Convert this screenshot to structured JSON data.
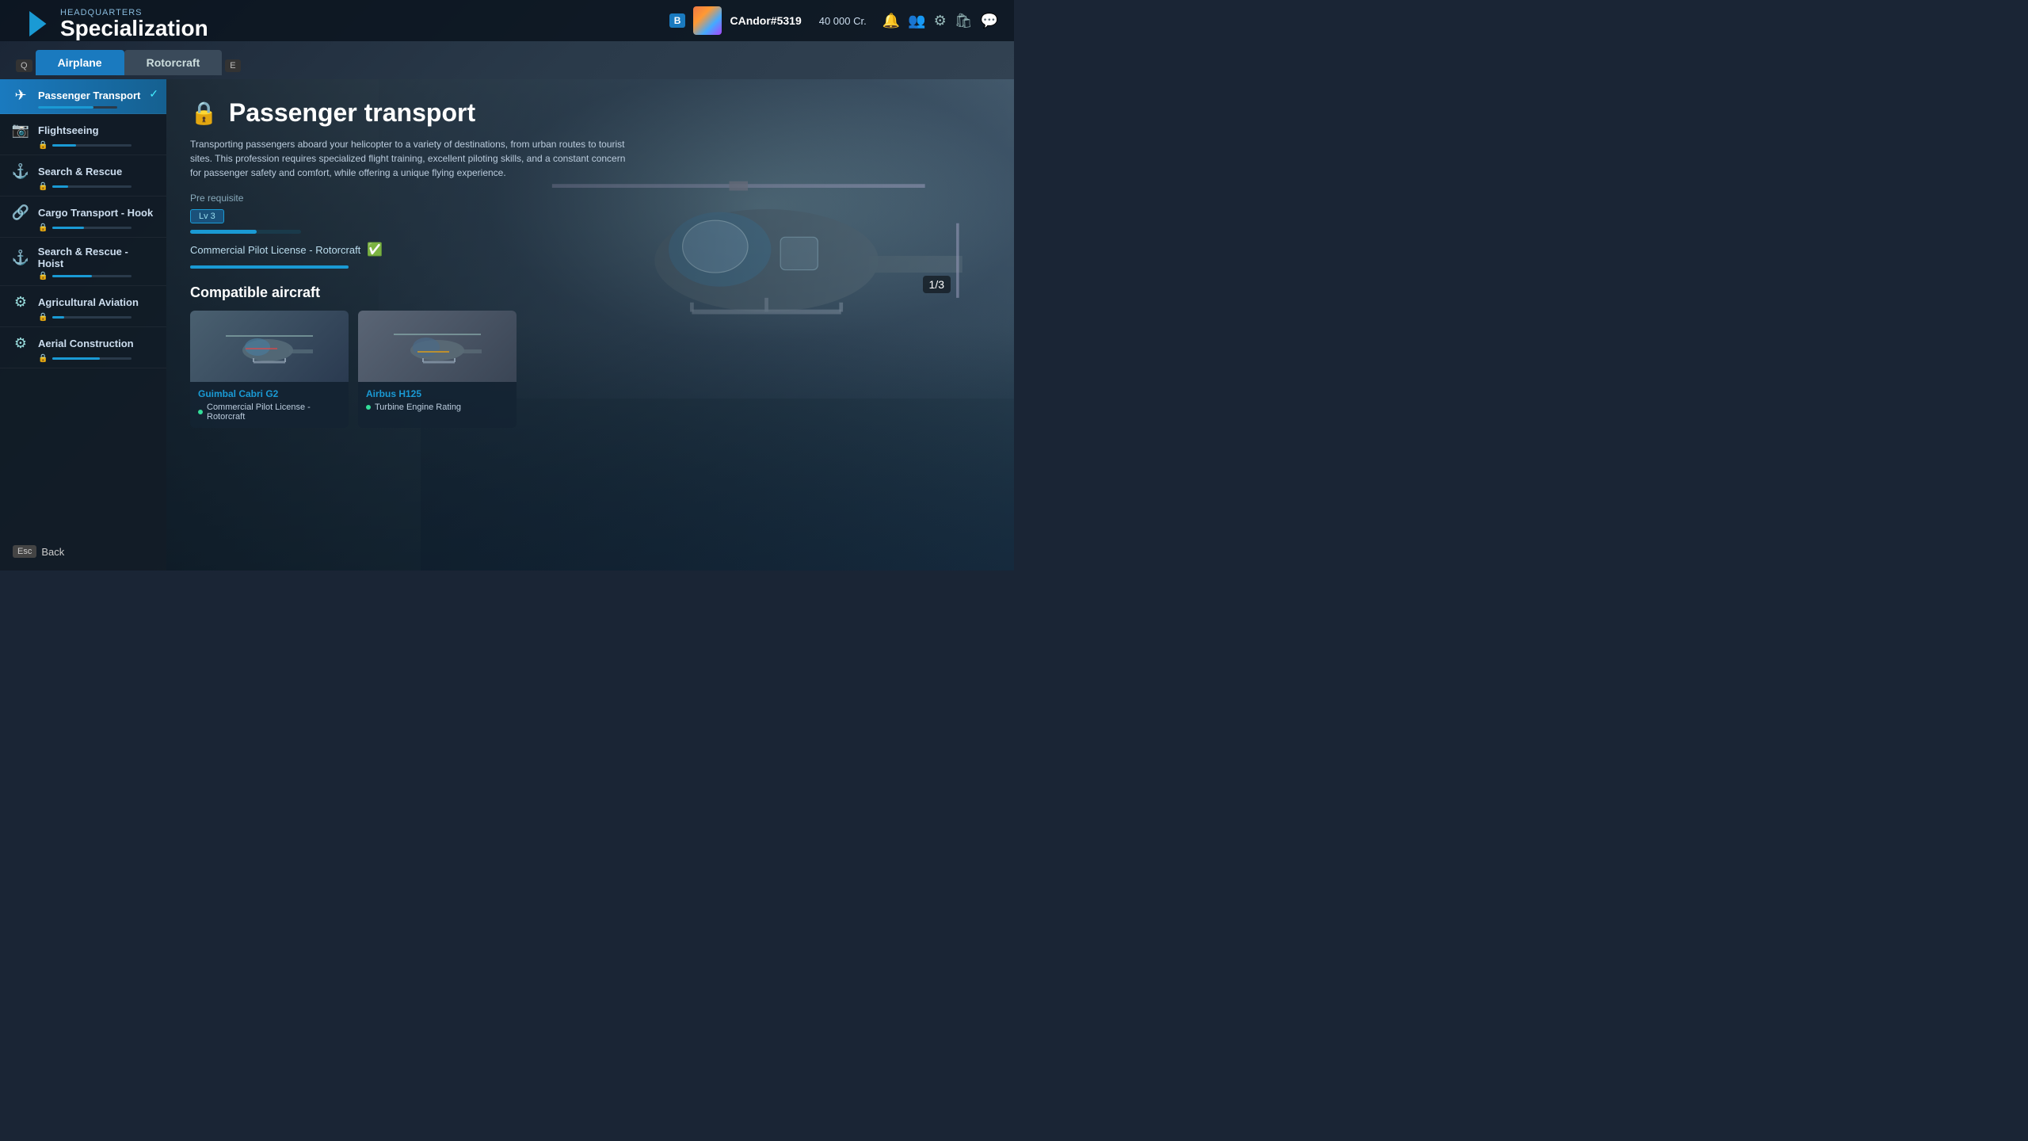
{
  "topbar": {
    "b_badge": "B",
    "username": "CAndor#5319",
    "credits": "40 000 Cr.",
    "e_key": "E",
    "q_key": "Q"
  },
  "header": {
    "subtitle": "Headquarters",
    "title": "Specialization"
  },
  "tabs": [
    {
      "label": "Airplane",
      "active": true
    },
    {
      "label": "Rotorcraft",
      "active": false
    }
  ],
  "sidebar": {
    "items": [
      {
        "id": "passenger-transport",
        "label": "Passenger Transport",
        "icon": "✈",
        "active": true,
        "progress": 70,
        "locked": false,
        "checked": true
      },
      {
        "id": "flightseeing",
        "label": "Flightseeing",
        "icon": "📷",
        "active": false,
        "progress": 30,
        "locked": true
      },
      {
        "id": "search-rescue",
        "label": "Search & Rescue",
        "icon": "⚓",
        "active": false,
        "progress": 20,
        "locked": true
      },
      {
        "id": "cargo-transport-hook",
        "label": "Cargo Transport - Hook",
        "icon": "🔗",
        "active": false,
        "progress": 40,
        "locked": true
      },
      {
        "id": "search-rescue-hoist",
        "label": "Search & Rescue - Hoist",
        "icon": "⚓",
        "active": false,
        "progress": 50,
        "locked": true
      },
      {
        "id": "agricultural-aviation",
        "label": "Agricultural Aviation",
        "icon": "⚙",
        "active": false,
        "progress": 15,
        "locked": true
      },
      {
        "id": "aerial-construction",
        "label": "Aerial Construction",
        "icon": "⚙",
        "active": false,
        "progress": 60,
        "locked": true
      }
    ]
  },
  "detail": {
    "title": "Passenger transport",
    "description": "Transporting passengers aboard your helicopter to a variety of destinations, from urban routes to tourist sites. This profession requires specialized flight training, excellent piloting skills, and a constant concern for passenger safety and comfort, while offering a unique flying experience.",
    "prereq_label": "Pre requisite",
    "prereq_level": "Lv 3",
    "prereq_bar_progress": 60,
    "prereq_item": "Commercial Pilot License - Rotorcraft",
    "prereq_item_bar_progress": 100,
    "counter": "1/3",
    "compatible_title": "Compatible aircraft",
    "aircraft": [
      {
        "name": "Guimbal Cabri G2",
        "req": "Commercial Pilot License - Rotorcraft"
      },
      {
        "name": "Airbus H125",
        "req": "Turbine Engine Rating"
      }
    ]
  },
  "footer": {
    "esc_key": "Esc",
    "back_label": "Back"
  }
}
